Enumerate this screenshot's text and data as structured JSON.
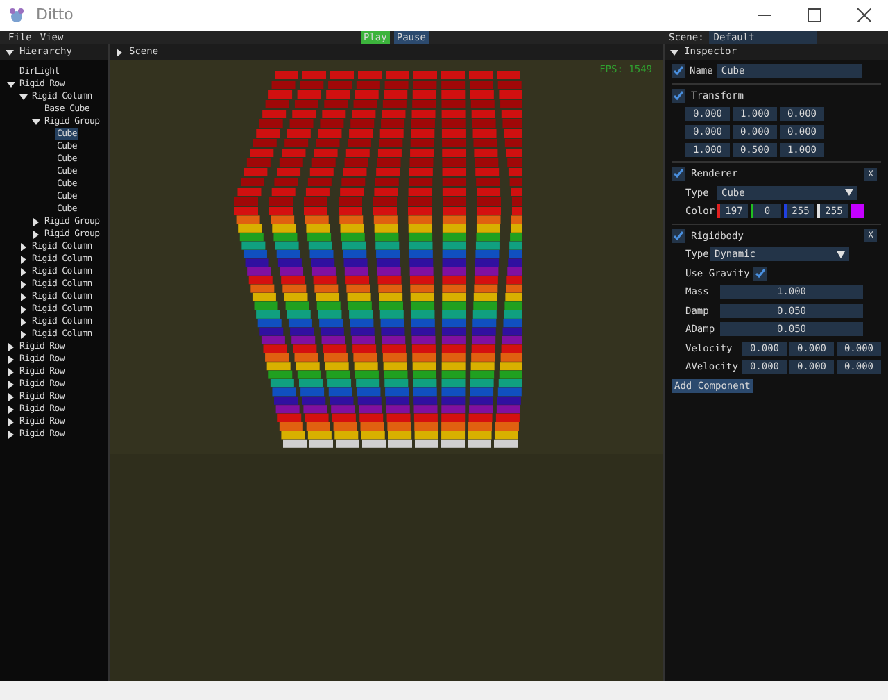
{
  "window": {
    "title": "Ditto"
  },
  "menu": [
    "File",
    "View"
  ],
  "playback": [
    {
      "label": "Play",
      "selected": true
    },
    {
      "label": "Pause",
      "selected": false
    }
  ],
  "scene_selector": {
    "label": "Scene:",
    "value": "Default"
  },
  "hierarchy": {
    "title": "Hierarchy",
    "expanded": true,
    "items": [
      {
        "label": "DirLight",
        "selected": false
      },
      {
        "label": "Rigid Row",
        "selected": false,
        "expanded": true,
        "children": [
          {
            "label": "Rigid Column",
            "selected": false,
            "expanded": true,
            "children": [
              {
                "label": "Base Cube",
                "selected": false
              },
              {
                "label": "Rigid Group",
                "selected": false,
                "expanded": true,
                "children": [
                  {
                    "label": "Cube",
                    "selected": true
                  },
                  {
                    "label": "Cube",
                    "selected": false
                  },
                  {
                    "label": "Cube",
                    "selected": false
                  },
                  {
                    "label": "Cube",
                    "selected": false
                  },
                  {
                    "label": "Cube",
                    "selected": false
                  },
                  {
                    "label": "Cube",
                    "selected": false
                  },
                  {
                    "label": "Cube",
                    "selected": false
                  }
                ]
              },
              {
                "label": "Rigid Group",
                "selected": false,
                "expanded": false
              },
              {
                "label": "Rigid Group",
                "selected": false,
                "expanded": false
              }
            ]
          },
          {
            "label": "Rigid Column",
            "selected": false,
            "expanded": false
          },
          {
            "label": "Rigid Column",
            "selected": false,
            "expanded": false
          },
          {
            "label": "Rigid Column",
            "selected": false,
            "expanded": false
          },
          {
            "label": "Rigid Column",
            "selected": false,
            "expanded": false
          },
          {
            "label": "Rigid Column",
            "selected": false,
            "expanded": false
          },
          {
            "label": "Rigid Column",
            "selected": false,
            "expanded": false
          },
          {
            "label": "Rigid Column",
            "selected": false,
            "expanded": false
          },
          {
            "label": "Rigid Column",
            "selected": false,
            "expanded": false
          }
        ]
      },
      {
        "label": "Rigid Row",
        "selected": false,
        "expanded": false
      },
      {
        "label": "Rigid Row",
        "selected": false,
        "expanded": false
      },
      {
        "label": "Rigid Row",
        "selected": false,
        "expanded": false
      },
      {
        "label": "Rigid Row",
        "selected": false,
        "expanded": false
      },
      {
        "label": "Rigid Row",
        "selected": false,
        "expanded": false
      },
      {
        "label": "Rigid Row",
        "selected": false,
        "expanded": false
      },
      {
        "label": "Rigid Row",
        "selected": false,
        "expanded": false
      },
      {
        "label": "Rigid Row",
        "selected": false,
        "expanded": false
      }
    ]
  },
  "scene": {
    "title": "Scene",
    "expanded": false,
    "fps": "FPS: 1549"
  },
  "inspector": {
    "title": "Inspector",
    "expanded": true,
    "name": {
      "enabled": true,
      "label": "Name",
      "value": "Cube"
    },
    "transform": {
      "enabled": true,
      "title": "Transform",
      "values": [
        [
          "0.000",
          "1.000",
          "0.000"
        ],
        [
          "0.000",
          "0.000",
          "0.000"
        ],
        [
          "1.000",
          "0.500",
          "1.000"
        ]
      ]
    },
    "renderer": {
      "enabled": true,
      "title": "Renderer",
      "close": "X",
      "type_label": "Type",
      "type": "Cube",
      "color_label": "Color",
      "channels": [
        {
          "value": "197",
          "color": "#e02020"
        },
        {
          "value": "0",
          "color": "#20c020"
        },
        {
          "value": "255",
          "color": "#2040e0"
        },
        {
          "value": "255",
          "color": "#e0e0e0"
        }
      ]
    },
    "rigidbody": {
      "enabled": true,
      "title": "Rigidbody",
      "close": "X",
      "type_label": "Type",
      "type": "Dynamic",
      "gravity_label": "Use Gravity",
      "use_gravity": true,
      "scalars": [
        {
          "label": "Mass",
          "value": "1.000"
        },
        {
          "label": "Damp",
          "value": "0.050"
        },
        {
          "label": "ADamp",
          "value": "0.050"
        }
      ],
      "vectors": [
        {
          "label": "Velocity",
          "values": [
            "0.000",
            "0.000",
            "0.000"
          ]
        },
        {
          "label": "AVelocity",
          "values": [
            "0.000",
            "0.000",
            "0.000"
          ]
        }
      ]
    },
    "add_button": "Add Component"
  }
}
